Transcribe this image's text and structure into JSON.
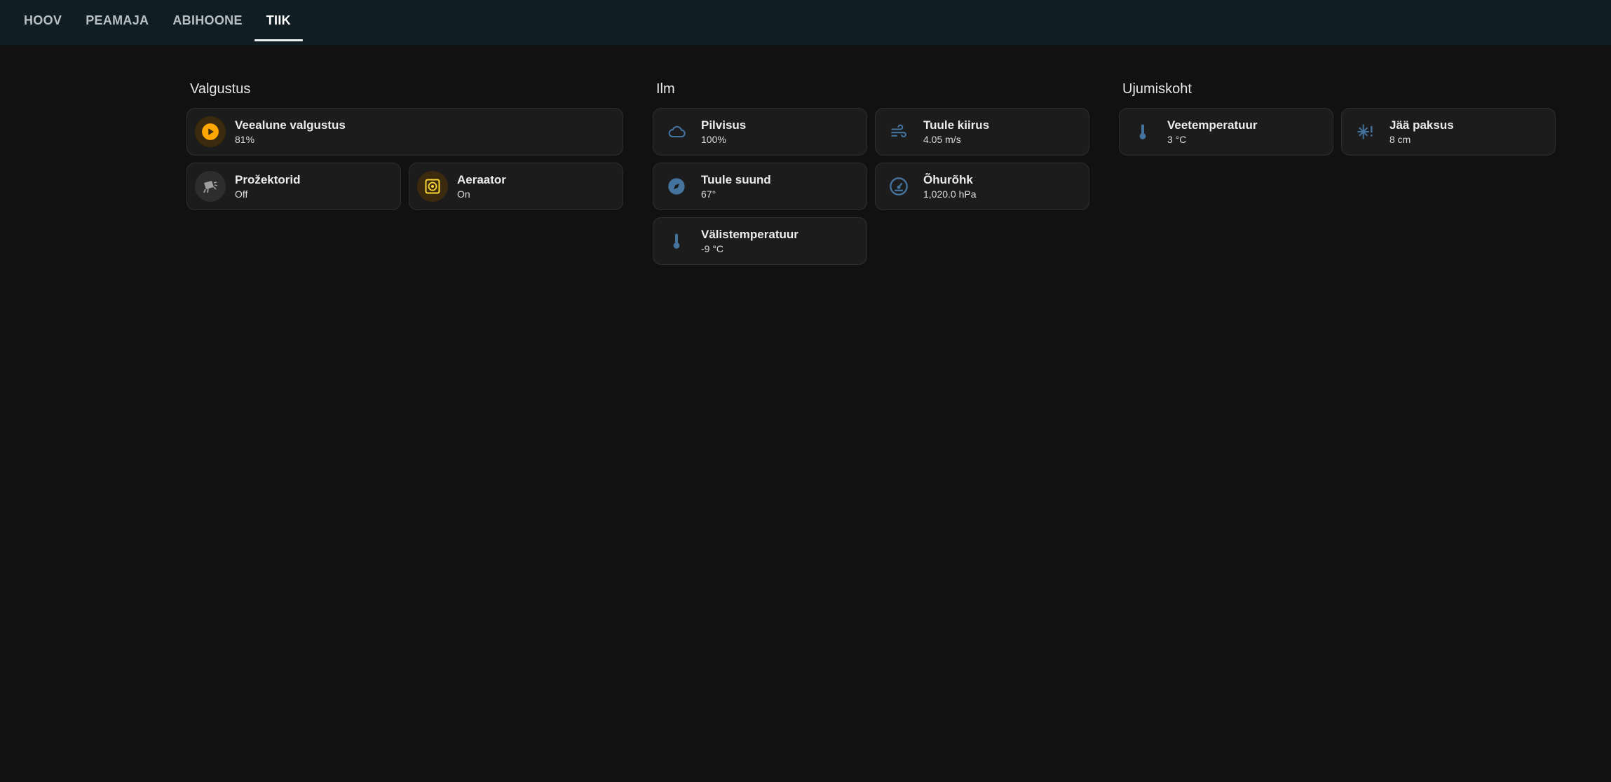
{
  "tabs": [
    {
      "label": "HOOV",
      "active": false
    },
    {
      "label": "PEAMAJA",
      "active": false
    },
    {
      "label": "ABIHOONE",
      "active": false
    },
    {
      "label": "TIIK",
      "active": true
    }
  ],
  "colors": {
    "accent_active": "#ffa600",
    "aerator_icon": "#fdd835",
    "sensor_icon": "#44739e",
    "off_icon": "#9e9e9e"
  },
  "sections": {
    "valgustus": {
      "title": "Valgustus",
      "cards": [
        {
          "name": "Veealune valgustus",
          "state": "81%",
          "icon": "play-circle-icon"
        },
        {
          "name": "Prožektorid",
          "state": "Off",
          "icon": "spotlight-icon"
        },
        {
          "name": "Aeraator",
          "state": "On",
          "icon": "fan-box-icon"
        }
      ]
    },
    "ilm": {
      "title": "Ilm",
      "cards": [
        {
          "name": "Pilvisus",
          "state": "100%",
          "icon": "cloud-icon"
        },
        {
          "name": "Tuule kiirus",
          "state": "4.05 m/s",
          "icon": "wind-icon"
        },
        {
          "name": "Tuule suund",
          "state": "67°",
          "icon": "compass-icon"
        },
        {
          "name": "Õhurõhk",
          "state": "1,020.0 hPa",
          "icon": "gauge-icon"
        },
        {
          "name": "Välistemperatuur",
          "state": "-9 °C",
          "icon": "thermometer-icon"
        }
      ]
    },
    "ujumiskoht": {
      "title": "Ujumiskoht",
      "cards": [
        {
          "name": "Veetemperatuur",
          "state": "3 °C",
          "icon": "thermometer-icon"
        },
        {
          "name": "Jää paksus",
          "state": "8 cm",
          "icon": "snowflake-alert-icon"
        }
      ]
    }
  }
}
